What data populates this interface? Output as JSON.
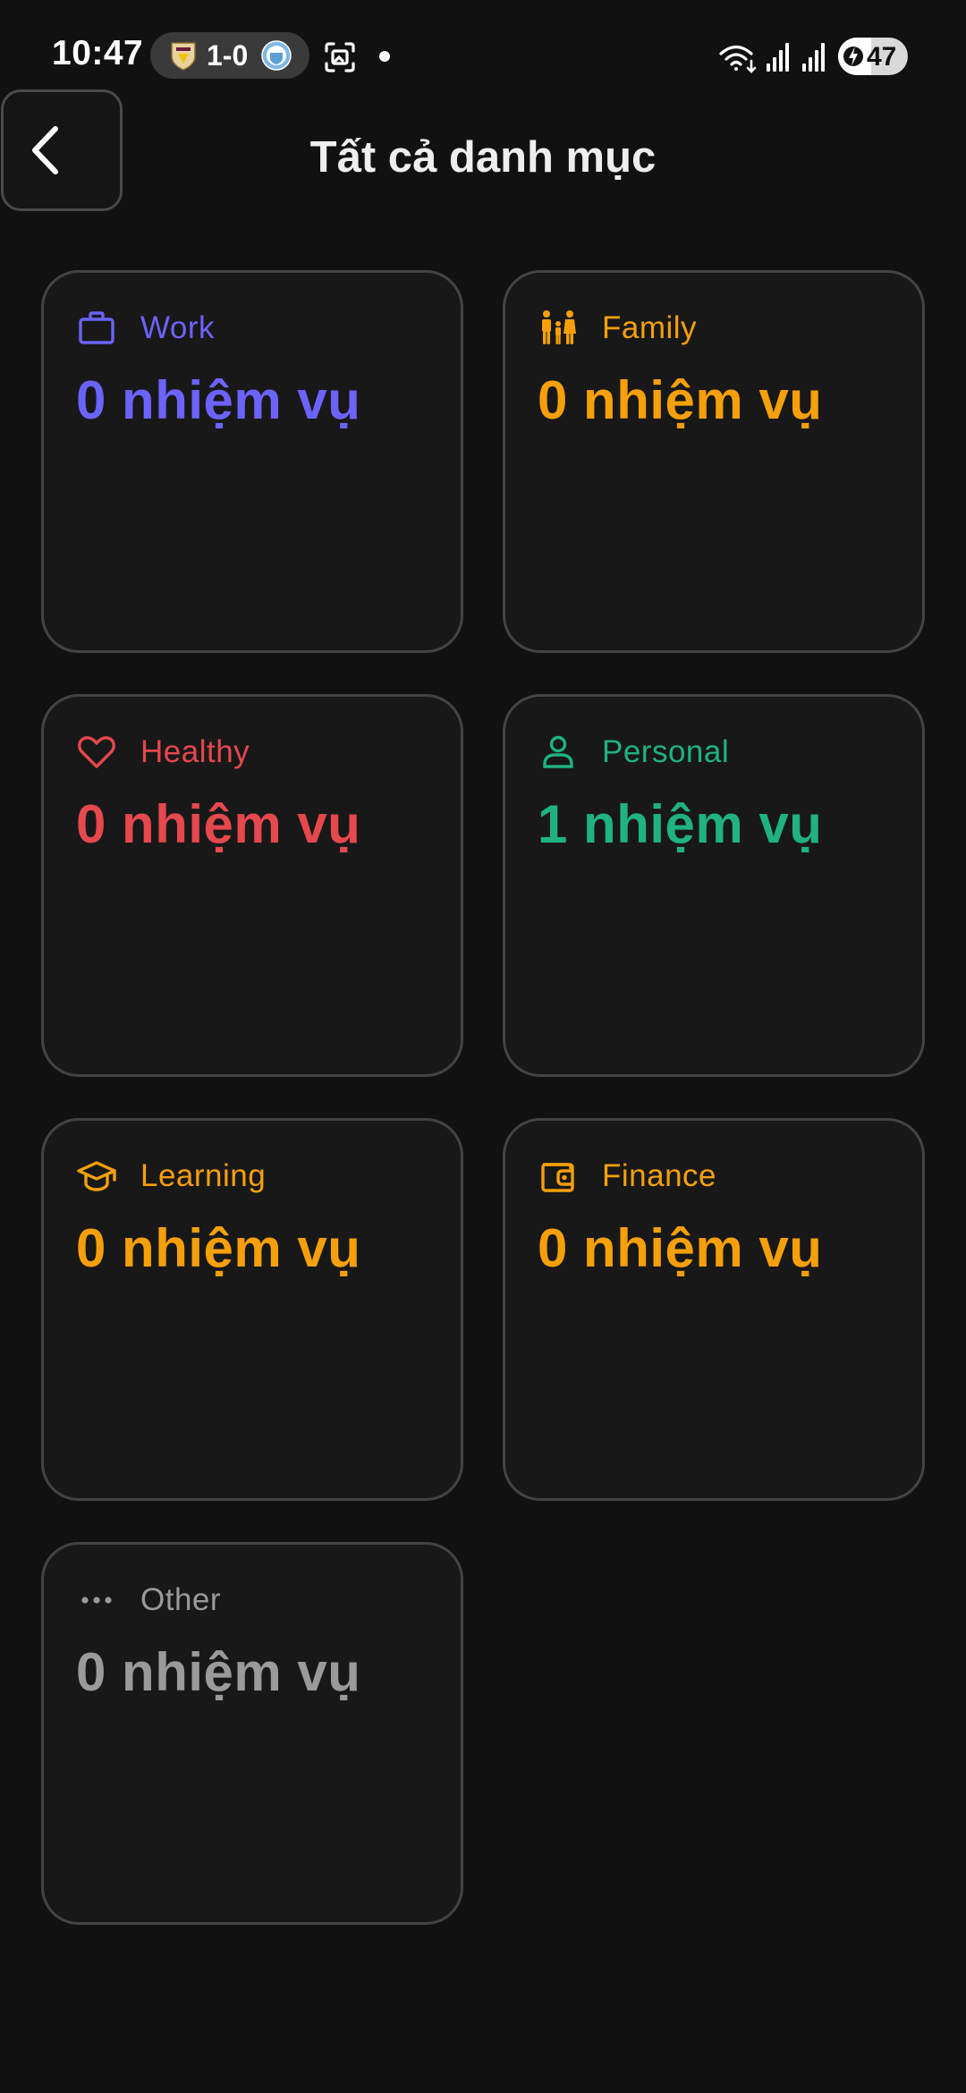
{
  "status_bar": {
    "time": "10:47",
    "score": "1-0",
    "battery": "47",
    "battery_level": 0.47
  },
  "header": {
    "title": "Tất cả danh mục"
  },
  "categories": [
    {
      "label": "Work",
      "count": "0 nhiệm vụ",
      "color": "#6c63ff",
      "icon": "briefcase-icon"
    },
    {
      "label": "Family",
      "count": "0 nhiệm vụ",
      "color": "#f5a00a",
      "icon": "family-icon"
    },
    {
      "label": "Healthy",
      "count": "0 nhiệm vụ",
      "color": "#e5484d",
      "icon": "heart-icon"
    },
    {
      "label": "Personal",
      "count": "1 nhiệm vụ",
      "color": "#20b27f",
      "icon": "person-icon"
    },
    {
      "label": "Learning",
      "count": "0 nhiệm vụ",
      "color": "#f5a00a",
      "icon": "graduation-cap-icon"
    },
    {
      "label": "Finance",
      "count": "0 nhiệm vụ",
      "color": "#f5a00a",
      "icon": "wallet-icon"
    },
    {
      "label": "Other",
      "count": "0 nhiệm vụ",
      "color": "#9a9a9a",
      "icon": "more-dots-icon"
    }
  ]
}
